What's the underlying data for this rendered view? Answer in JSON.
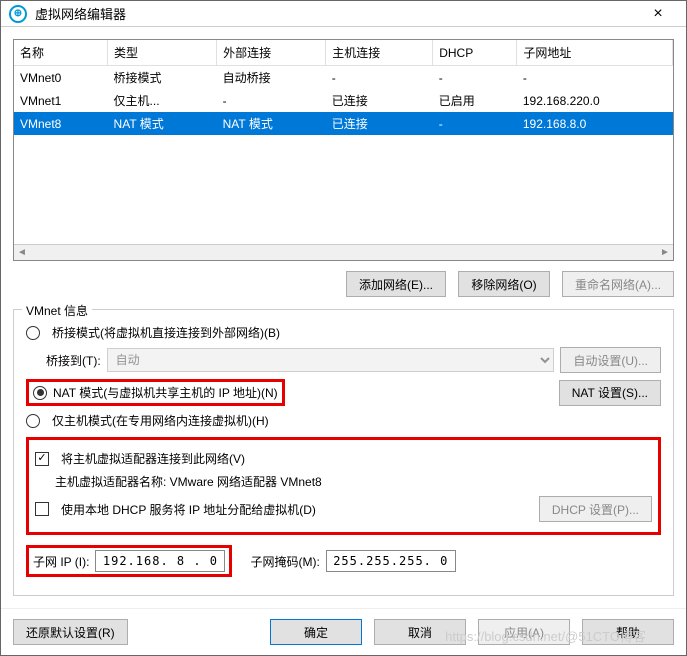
{
  "window": {
    "title": "虚拟网络编辑器",
    "close": "×"
  },
  "table": {
    "cols": [
      "名称",
      "类型",
      "外部连接",
      "主机连接",
      "DHCP",
      "子网地址"
    ],
    "rows": [
      {
        "c": [
          "VMnet0",
          "桥接模式",
          "自动桥接",
          "-",
          "-",
          "-"
        ],
        "sel": false
      },
      {
        "c": [
          "VMnet1",
          "仅主机...",
          "-",
          "已连接",
          "已启用",
          "192.168.220.0"
        ],
        "sel": false
      },
      {
        "c": [
          "VMnet8",
          "NAT 模式",
          "NAT 模式",
          "已连接",
          "-",
          "192.168.8.0"
        ],
        "sel": true
      }
    ]
  },
  "buttons": {
    "add": "添加网络(E)...",
    "remove": "移除网络(O)",
    "rename": "重命名网络(A)...",
    "auto": "自动设置(U)...",
    "nat": "NAT 设置(S)...",
    "dhcp": "DHCP 设置(P)..."
  },
  "fieldset": {
    "legend": "VMnet 信息",
    "bridged": "桥接模式(将虚拟机直接连接到外部网络)(B)",
    "bridge_to_label": "桥接到(T):",
    "bridge_to_value": "自动",
    "nat": "NAT 模式(与虚拟机共享主机的 IP 地址)(N)",
    "hostonly": "仅主机模式(在专用网络内连接虚拟机)(H)",
    "connect_host": "将主机虚拟适配器连接到此网络(V)",
    "adapter_name": "主机虚拟适配器名称: VMware 网络适配器 VMnet8",
    "use_dhcp": "使用本地 DHCP 服务将 IP 地址分配给虚拟机(D)",
    "subnet_ip_label": "子网 IP (I):",
    "subnet_ip": "192.168. 8 . 0",
    "subnet_mask_label": "子网掩码(M):",
    "subnet_mask": "255.255.255. 0"
  },
  "footer": {
    "restore": "还原默认设置(R)",
    "ok": "确定",
    "cancel": "取消",
    "apply": "应用(A)",
    "help": "帮助"
  },
  "watermark": "https://blog.csdn.net/@51CTO博客"
}
